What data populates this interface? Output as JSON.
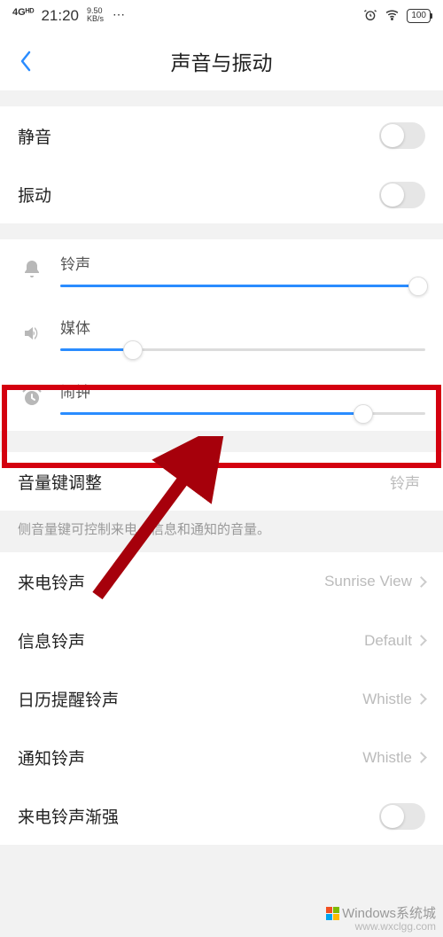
{
  "status": {
    "signal": "4Gᴴᴰ",
    "time": "21:20",
    "speed_top": "9.50",
    "speed_bot": "KB/s",
    "battery": "100"
  },
  "nav": {
    "title": "声音与振动"
  },
  "sec1": {
    "mute": "静音",
    "vibrate": "振动"
  },
  "sliders": {
    "ring": "铃声",
    "media": "媒体",
    "alarm": "闹钟"
  },
  "vol_key": {
    "label": "音量键调整",
    "value": "铃声",
    "desc": "侧音量键可控制来电、信息和通知的音量。"
  },
  "tones": {
    "incoming": {
      "label": "来电铃声",
      "value": "Sunrise View"
    },
    "message": {
      "label": "信息铃声",
      "value": "Default"
    },
    "calendar": {
      "label": "日历提醒铃声",
      "value": "Whistle"
    },
    "notify": {
      "label": "通知铃声",
      "value": "Whistle"
    },
    "crescendo": {
      "label": "来电铃声渐强"
    }
  },
  "watermark": {
    "brand": "Windows系统城",
    "url": "www.wxclgg.com"
  }
}
